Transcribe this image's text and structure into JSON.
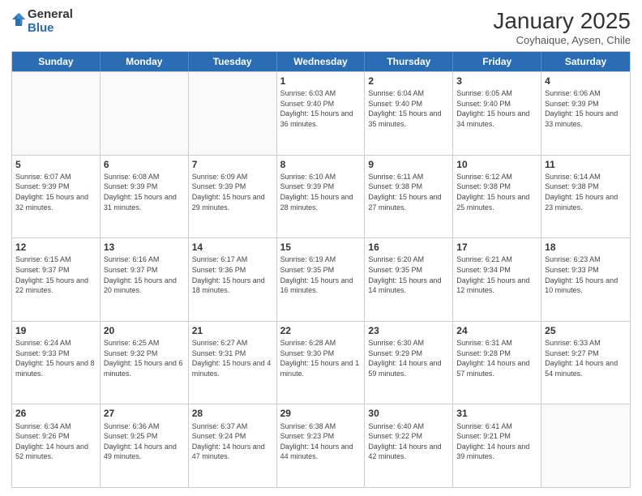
{
  "header": {
    "logo_general": "General",
    "logo_blue": "Blue",
    "title": "January 2025",
    "subtitle": "Coyhaique, Aysen, Chile"
  },
  "weekdays": [
    "Sunday",
    "Monday",
    "Tuesday",
    "Wednesday",
    "Thursday",
    "Friday",
    "Saturday"
  ],
  "weeks": [
    [
      {
        "day": "",
        "text": ""
      },
      {
        "day": "",
        "text": ""
      },
      {
        "day": "",
        "text": ""
      },
      {
        "day": "1",
        "text": "Sunrise: 6:03 AM\nSunset: 9:40 PM\nDaylight: 15 hours and 36 minutes."
      },
      {
        "day": "2",
        "text": "Sunrise: 6:04 AM\nSunset: 9:40 PM\nDaylight: 15 hours and 35 minutes."
      },
      {
        "day": "3",
        "text": "Sunrise: 6:05 AM\nSunset: 9:40 PM\nDaylight: 15 hours and 34 minutes."
      },
      {
        "day": "4",
        "text": "Sunrise: 6:06 AM\nSunset: 9:39 PM\nDaylight: 15 hours and 33 minutes."
      }
    ],
    [
      {
        "day": "5",
        "text": "Sunrise: 6:07 AM\nSunset: 9:39 PM\nDaylight: 15 hours and 32 minutes."
      },
      {
        "day": "6",
        "text": "Sunrise: 6:08 AM\nSunset: 9:39 PM\nDaylight: 15 hours and 31 minutes."
      },
      {
        "day": "7",
        "text": "Sunrise: 6:09 AM\nSunset: 9:39 PM\nDaylight: 15 hours and 29 minutes."
      },
      {
        "day": "8",
        "text": "Sunrise: 6:10 AM\nSunset: 9:39 PM\nDaylight: 15 hours and 28 minutes."
      },
      {
        "day": "9",
        "text": "Sunrise: 6:11 AM\nSunset: 9:38 PM\nDaylight: 15 hours and 27 minutes."
      },
      {
        "day": "10",
        "text": "Sunrise: 6:12 AM\nSunset: 9:38 PM\nDaylight: 15 hours and 25 minutes."
      },
      {
        "day": "11",
        "text": "Sunrise: 6:14 AM\nSunset: 9:38 PM\nDaylight: 15 hours and 23 minutes."
      }
    ],
    [
      {
        "day": "12",
        "text": "Sunrise: 6:15 AM\nSunset: 9:37 PM\nDaylight: 15 hours and 22 minutes."
      },
      {
        "day": "13",
        "text": "Sunrise: 6:16 AM\nSunset: 9:37 PM\nDaylight: 15 hours and 20 minutes."
      },
      {
        "day": "14",
        "text": "Sunrise: 6:17 AM\nSunset: 9:36 PM\nDaylight: 15 hours and 18 minutes."
      },
      {
        "day": "15",
        "text": "Sunrise: 6:19 AM\nSunset: 9:35 PM\nDaylight: 15 hours and 16 minutes."
      },
      {
        "day": "16",
        "text": "Sunrise: 6:20 AM\nSunset: 9:35 PM\nDaylight: 15 hours and 14 minutes."
      },
      {
        "day": "17",
        "text": "Sunrise: 6:21 AM\nSunset: 9:34 PM\nDaylight: 15 hours and 12 minutes."
      },
      {
        "day": "18",
        "text": "Sunrise: 6:23 AM\nSunset: 9:33 PM\nDaylight: 15 hours and 10 minutes."
      }
    ],
    [
      {
        "day": "19",
        "text": "Sunrise: 6:24 AM\nSunset: 9:33 PM\nDaylight: 15 hours and 8 minutes."
      },
      {
        "day": "20",
        "text": "Sunrise: 6:25 AM\nSunset: 9:32 PM\nDaylight: 15 hours and 6 minutes."
      },
      {
        "day": "21",
        "text": "Sunrise: 6:27 AM\nSunset: 9:31 PM\nDaylight: 15 hours and 4 minutes."
      },
      {
        "day": "22",
        "text": "Sunrise: 6:28 AM\nSunset: 9:30 PM\nDaylight: 15 hours and 1 minute."
      },
      {
        "day": "23",
        "text": "Sunrise: 6:30 AM\nSunset: 9:29 PM\nDaylight: 14 hours and 59 minutes."
      },
      {
        "day": "24",
        "text": "Sunrise: 6:31 AM\nSunset: 9:28 PM\nDaylight: 14 hours and 57 minutes."
      },
      {
        "day": "25",
        "text": "Sunrise: 6:33 AM\nSunset: 9:27 PM\nDaylight: 14 hours and 54 minutes."
      }
    ],
    [
      {
        "day": "26",
        "text": "Sunrise: 6:34 AM\nSunset: 9:26 PM\nDaylight: 14 hours and 52 minutes."
      },
      {
        "day": "27",
        "text": "Sunrise: 6:36 AM\nSunset: 9:25 PM\nDaylight: 14 hours and 49 minutes."
      },
      {
        "day": "28",
        "text": "Sunrise: 6:37 AM\nSunset: 9:24 PM\nDaylight: 14 hours and 47 minutes."
      },
      {
        "day": "29",
        "text": "Sunrise: 6:38 AM\nSunset: 9:23 PM\nDaylight: 14 hours and 44 minutes."
      },
      {
        "day": "30",
        "text": "Sunrise: 6:40 AM\nSunset: 9:22 PM\nDaylight: 14 hours and 42 minutes."
      },
      {
        "day": "31",
        "text": "Sunrise: 6:41 AM\nSunset: 9:21 PM\nDaylight: 14 hours and 39 minutes."
      },
      {
        "day": "",
        "text": ""
      }
    ]
  ]
}
